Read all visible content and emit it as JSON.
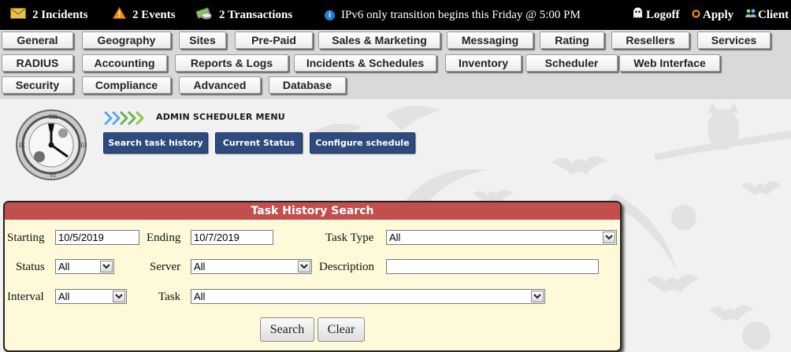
{
  "topbar": {
    "incidents": "2 Incidents",
    "events": "2 Events",
    "transactions": "2 Transactions",
    "notice": "IPv6 only transition begins this Friday @ 5:00 PM",
    "logoff": "Logoff",
    "apply": "Apply",
    "client": "Client",
    "icons": {
      "incidents": "envelope-icon",
      "events": "warning-icon",
      "transactions": "money-icon",
      "notice": "info-icon",
      "logoff": "ghost-icon",
      "apply": "apply-icon",
      "client": "users-icon"
    }
  },
  "nav": {
    "row1": [
      "General",
      "Geography",
      "Sites",
      "Pre-Paid",
      "Sales & Marketing",
      "Messaging",
      "Rating",
      "Resellers",
      "Services"
    ],
    "row2": [
      "RADIUS",
      "Accounting",
      "Reports & Logs",
      "Incidents & Schedules",
      "Inventory",
      "Scheduler",
      "Web Interface"
    ],
    "row3": [
      "Security",
      "Compliance",
      "Advanced",
      "Database"
    ]
  },
  "menu": {
    "title": "ADMIN SCHEDULER MENU",
    "buttons": [
      "Search task history",
      "Current Status",
      "Configure schedule"
    ]
  },
  "panel": {
    "title": "Task History Search",
    "starting_label": "Starting",
    "starting_value": "10/5/2019",
    "ending_label": "Ending",
    "ending_value": "10/7/2019",
    "task_type_label": "Task Type",
    "task_type_value": "All",
    "status_label": "Status",
    "status_value": "All",
    "server_label": "Server",
    "server_value": "All",
    "description_label": "Description",
    "description_value": "",
    "interval_label": "Interval",
    "interval_value": "All",
    "task_label": "Task",
    "task_value": "All",
    "search_button": "Search",
    "clear_button": "Clear"
  },
  "colors": {
    "topbar_bg": "#000000",
    "nav_bg": "#d9d9d9",
    "menu_button_bg": "#2f4a7e",
    "panel_header_bg": "#c24e4e",
    "panel_bg": "#fefad9",
    "info_blue": "#1f7fd8",
    "warning_orange": "#f5891f"
  }
}
